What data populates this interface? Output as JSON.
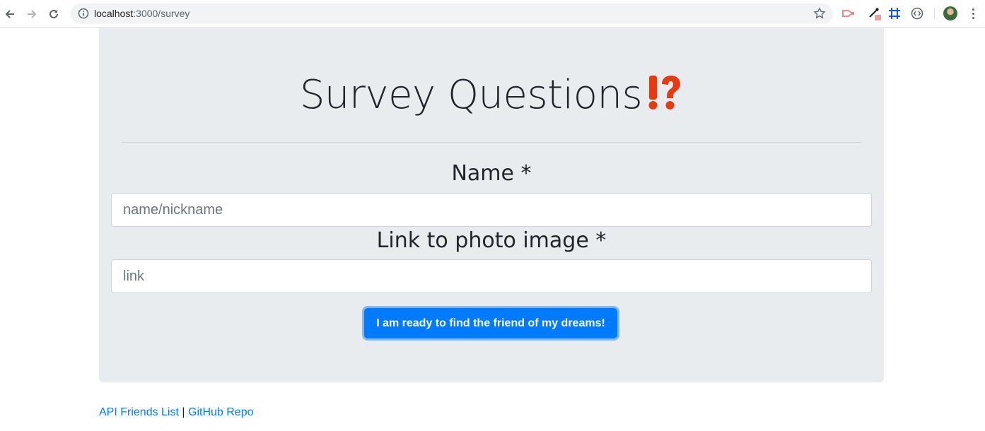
{
  "browser": {
    "url_host": "localhost",
    "url_rest": ":3000/survey"
  },
  "page": {
    "title": "Survey Questions",
    "title_emoji": "⁉"
  },
  "form": {
    "name_label": "Name *",
    "name_placeholder": "name/nickname",
    "photo_label": "Link to photo image *",
    "photo_placeholder": "link",
    "submit_label": "I am ready to find the friend of my dreams!"
  },
  "footer": {
    "api_link": "API Friends List",
    "separator": "|",
    "github_link": "GitHub Repo"
  },
  "colors": {
    "primary": "#007bff",
    "jumbotron_bg": "#e9ecef",
    "emoji": "#e53b13"
  }
}
